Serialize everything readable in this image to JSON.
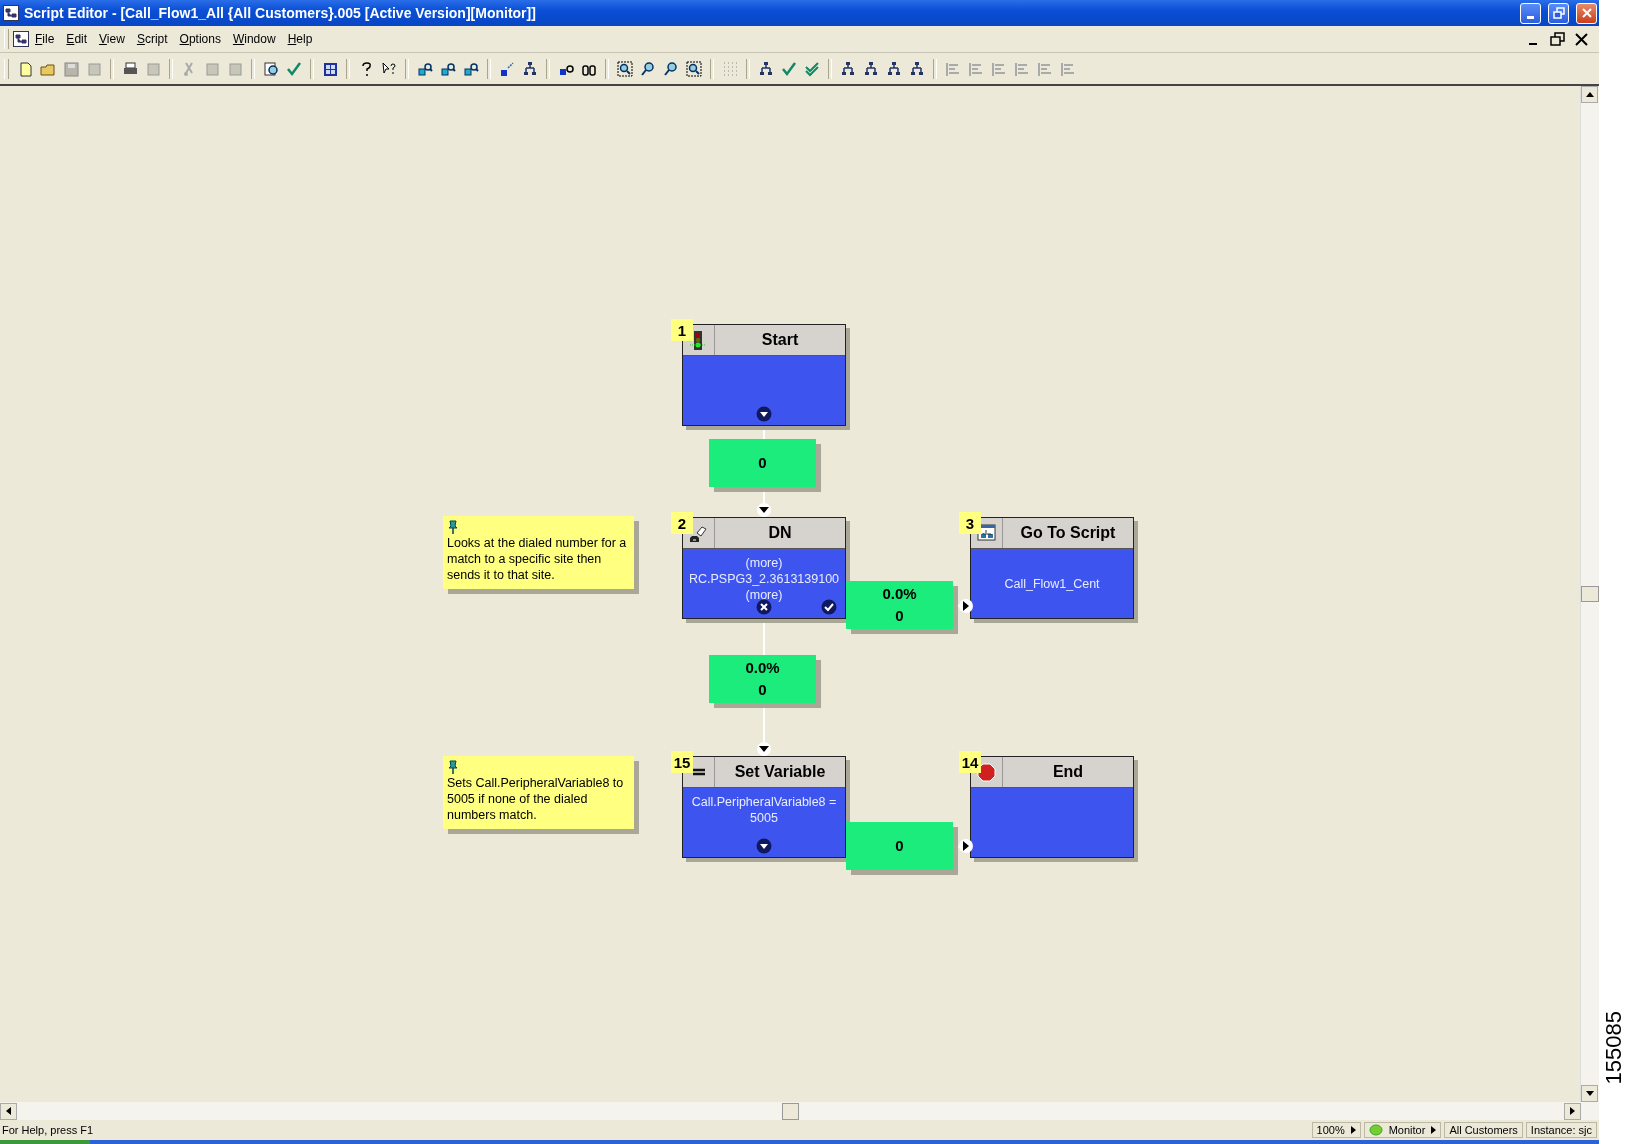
{
  "window": {
    "title": "Script Editor - [Call_Flow1_All {All Customers}.005 [Active Version][Monitor]]"
  },
  "menu": [
    {
      "label": "File"
    },
    {
      "label": "Edit"
    },
    {
      "label": "View"
    },
    {
      "label": "Script"
    },
    {
      "label": "Options"
    },
    {
      "label": "Window"
    },
    {
      "label": "Help"
    }
  ],
  "nodes": [
    {
      "number": "1",
      "title": "Start",
      "kind": "start"
    },
    {
      "number": "2",
      "title": "DN",
      "kind": "dn",
      "lines": [
        "(more)",
        "RC.PSPG3_2.3613139100",
        "(more)"
      ]
    },
    {
      "number": "3",
      "title": "Go To Script",
      "kind": "goto",
      "lines": [
        "Call_Flow1_Cent"
      ]
    },
    {
      "number": "15",
      "title": "Set Variable",
      "kind": "setvar",
      "lines": [
        "Call.PeripheralVariable8 = 5005"
      ]
    },
    {
      "number": "14",
      "title": "End",
      "kind": "end"
    }
  ],
  "counters": [
    {
      "lines": [
        "0"
      ]
    },
    {
      "lines": [
        "0.0%",
        "0"
      ]
    },
    {
      "lines": [
        "0.0%",
        "0"
      ]
    },
    {
      "lines": [
        "0"
      ]
    }
  ],
  "notes": [
    {
      "text": "Looks at the dialed number for a match to a specific site then sends it to that site."
    },
    {
      "text": "Sets Call.PeripheralVariable8 to 5005 if none of the dialed numbers match."
    }
  ],
  "status_bar": {
    "help": "For Help, press F1",
    "zoom": "100%",
    "mode": "Monitor",
    "customers": "All Customers",
    "instance": "Instance: sjc"
  },
  "figure_number": "155085"
}
